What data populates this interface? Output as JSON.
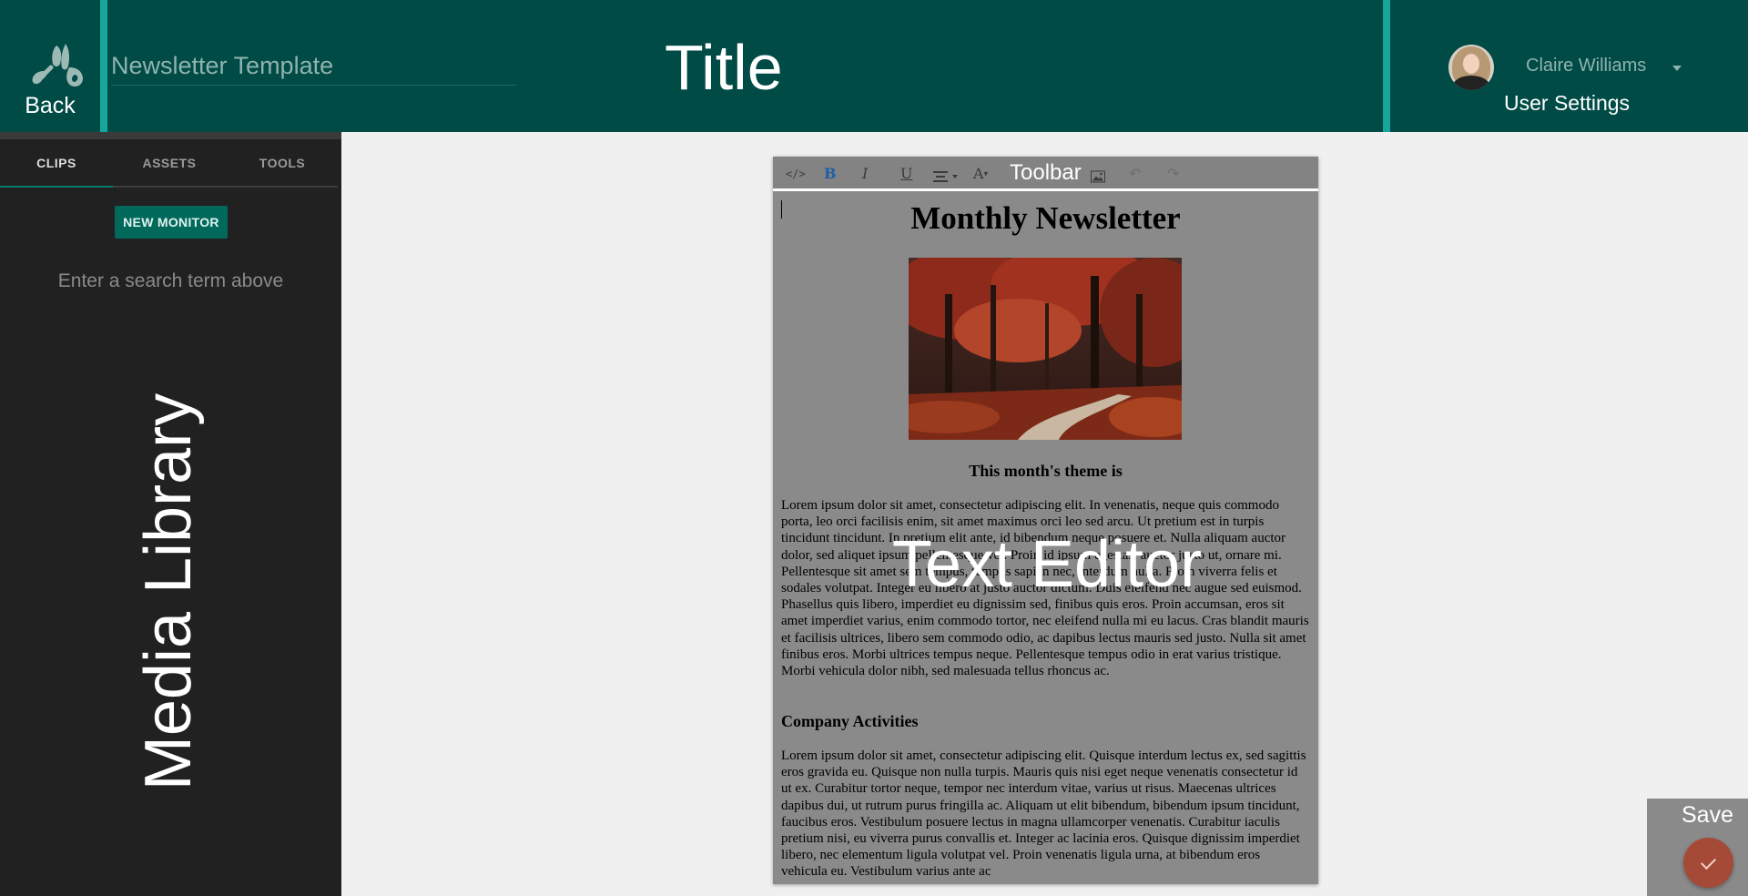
{
  "header": {
    "back_label": "Back",
    "doc_title_value": "Newsletter Template",
    "overlay_title": "Title",
    "user_name": "Claire Williams",
    "user_settings_label": "User Settings",
    "logo_icon": "brush-logo-icon",
    "colors": {
      "bar": "#004b46",
      "accent": "#16a79a"
    }
  },
  "sidebar": {
    "tabs": [
      {
        "label": "CLIPS",
        "active": true
      },
      {
        "label": "ASSETS",
        "active": false
      },
      {
        "label": "TOOLS",
        "active": false
      }
    ],
    "new_monitor_label": "NEW MONITOR",
    "search_hint": "Enter a search term above",
    "overlay_label": "Media Library"
  },
  "toolbar": {
    "overlay_label": "Toolbar",
    "icons": [
      "code-icon",
      "bold-icon",
      "italic-icon",
      "underline-icon",
      "align-icon",
      "font-color-icon",
      "image-icon",
      "undo-icon",
      "redo-icon"
    ],
    "bold_glyph": "B",
    "italic_glyph": "I",
    "underline_glyph": "U",
    "font_glyph": "A"
  },
  "editor": {
    "heading": "Monthly Newsletter",
    "theme_line": "This month's theme is",
    "paragraph1": "Lorem ipsum dolor sit amet, consectetur adipiscing elit. In venenatis, neque quis commodo porta, leo orci facilisis enim, sit amet maximus orci leo sed arcu. Ut pretium est in turpis tincidunt tincidunt. In pretium elit ante, id bibendum neque posuere et. Nulla aliquam auctor dolor, sed aliquet ipsum pellentesque vel. Proin id ipsum egestas, auctor justo ut, ornare mi. Pellentesque sit amet sem tempus, tempus sapien nec, interdum nulla. Proin viverra felis et sodales volutpat. Integer eu libero at justo auctor dictum. Duis eleifend nec augue sed euismod. Phasellus quis libero, imperdiet eu dignissim sed, finibus quis eros. Proin accumsan, eros sit amet imperdiet varius, enim commodo tortor, nec eleifend nulla mi eu lacus. Cras blandit mauris et facilisis ultrices, libero sem commodo odio, ac dapibus lectus mauris sed justo. Nulla sit amet finibus eros. Morbi ultrices tempus neque. Pellentesque tempus odio in erat varius tristique. Morbi vehicula dolor nibh, sed malesuada tellus rhoncus ac.",
    "company_heading": "Company Activities",
    "paragraph2": "Lorem ipsum dolor sit amet, consectetur adipiscing elit. Quisque interdum lectus ex, sed sagittis eros gravida eu. Quisque non nulla turpis. Mauris quis nisi eget neque venenatis consectetur id ut ex. Curabitur tortor neque, tempor nec interdum vitae, varius ut risus. Maecenas ultrices dapibus dui, ut rutrum purus fringilla ac. Aliquam ut elit bibendum, bibendum ipsum tincidunt, faucibus eros. Vestibulum posuere lectus in magna ullamcorper venenatis. Curabitur iaculis pretium nisi, eu viverra purus convallis et. Integer ac lacinia eros. Quisque dignissim imperdiet libero, nec elementum ligula volutpat vel. Proin venenatis ligula urna, at bibendum eros vehicula eu. Vestibulum varius ante ac",
    "overlay_label": "Text Editor"
  },
  "save": {
    "label": "Save",
    "icon": "check-icon",
    "fab_color": "#a64a38"
  }
}
